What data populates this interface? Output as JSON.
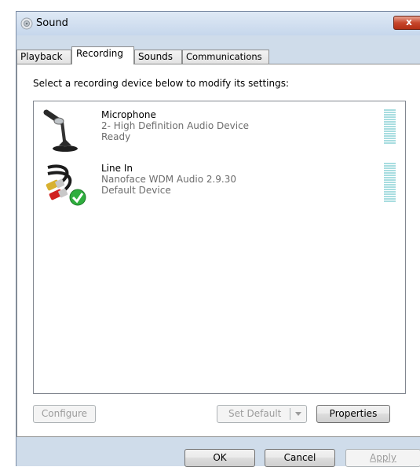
{
  "window": {
    "title": "Sound",
    "close_label": "x"
  },
  "tabs": [
    {
      "label": "Playback",
      "active": false
    },
    {
      "label": "Recording",
      "active": true
    },
    {
      "label": "Sounds",
      "active": false
    },
    {
      "label": "Communications",
      "active": false
    }
  ],
  "instruction": "Select a recording device below to modify its settings:",
  "devices": [
    {
      "name": "Microphone",
      "description": "2- High Definition Audio Device",
      "status": "Ready",
      "icon": "microphone-icon",
      "default": false,
      "level": 0
    },
    {
      "name": "Line In",
      "description": "Nanoface WDM Audio 2.9.30",
      "status": "Default Device",
      "icon": "rca-cable-icon",
      "default": true,
      "level": 0
    }
  ],
  "buttons": {
    "configure": "Configure",
    "set_default": "Set Default",
    "properties": "Properties",
    "ok": "OK",
    "cancel": "Cancel",
    "apply": "Apply"
  },
  "colors": {
    "window_frame": "#cfdcea",
    "level_meter": "#a8dde0",
    "default_check": "#2fae3e",
    "close_button": "#c7462b"
  }
}
